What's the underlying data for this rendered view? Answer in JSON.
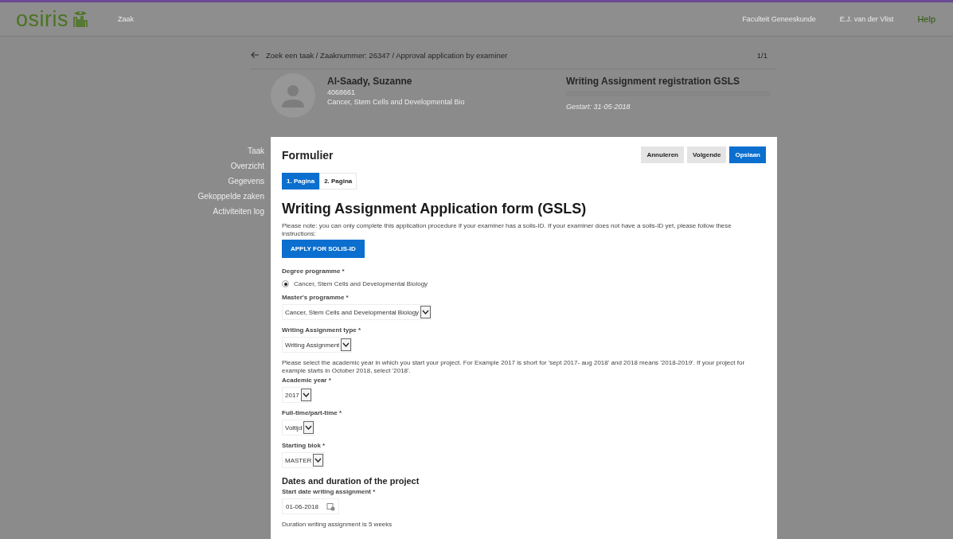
{
  "header": {
    "logo": "osiris",
    "section": "Zaak",
    "links": [
      {
        "label": "Faculteit Geneeskunde",
        "kind": "muted"
      },
      {
        "label": "E.J. van der Vlist",
        "kind": "muted"
      },
      {
        "label": "Help",
        "kind": "accent"
      }
    ]
  },
  "breadcrumb": {
    "path": "Zoek een taak / Zaaknummer: 26347 / Approval application by examiner",
    "pager": "1/1"
  },
  "student": {
    "name": "Al-Saady, Suzanne",
    "number": "4068661",
    "programme": "Cancer, Stem Cells and Developmental Bio"
  },
  "case": {
    "title": "Writing Assignment registration GSLS",
    "started": "Gestart: 31-05-2018"
  },
  "sidebar": {
    "items": [
      "Taak",
      "Overzicht",
      "Gegevens",
      "Gekoppelde zaken",
      "Activiteiten log"
    ]
  },
  "form": {
    "title": "Formulier",
    "buttons": [
      {
        "label": "Annuleren",
        "kind": "default"
      },
      {
        "label": "Volgende",
        "kind": "default"
      },
      {
        "label": "Opslaan",
        "kind": "primary"
      }
    ],
    "tabs": [
      {
        "label": "1. Pagina",
        "selected": true
      },
      {
        "label": "2. Pagina",
        "selected": false
      }
    ],
    "heading": "Writing Assignment Application form (GSLS)",
    "fields": [
      {
        "kind": "paragraph",
        "text": "Please note: you can only complete this application procedure if your examiner has a solis-ID. If your examiner does not have a solis-ID yet, please follow these instructions:"
      },
      {
        "kind": "button",
        "label": "APPLY FOR SOLIS-ID"
      },
      {
        "kind": "radio",
        "label": "Degree programme *",
        "options": [
          {
            "label": "Cancer, Stem Cells and Developmental Biology",
            "checked": true
          }
        ]
      },
      {
        "kind": "select",
        "label": "Master's programme *",
        "value": "Cancer, Stem Cells and Developmental Biology"
      },
      {
        "kind": "select",
        "label": "Writing Assignment type *",
        "value": "Writing Assignment"
      },
      {
        "kind": "paragraph",
        "text": "Please select the academic year in which you start your project. For Example 2017 is short for 'sept 2017- aug 2018' and 2018 means '2018-2019'. If your project for example starts in October 2018, select '2018'."
      },
      {
        "kind": "select",
        "label": "Academic year *",
        "value": "2017"
      },
      {
        "kind": "select",
        "label": "Full-time/part-time *",
        "value": "Voltijd"
      },
      {
        "kind": "select",
        "label": "Starting blok *",
        "value": "MASTER"
      },
      {
        "kind": "section",
        "text": "Dates and duration of the project"
      },
      {
        "kind": "date",
        "label": "Start date writing assignment *",
        "value": "01-06-2018"
      },
      {
        "kind": "paragraph",
        "text": "Duration writing assignment is 5 weeks"
      }
    ]
  }
}
